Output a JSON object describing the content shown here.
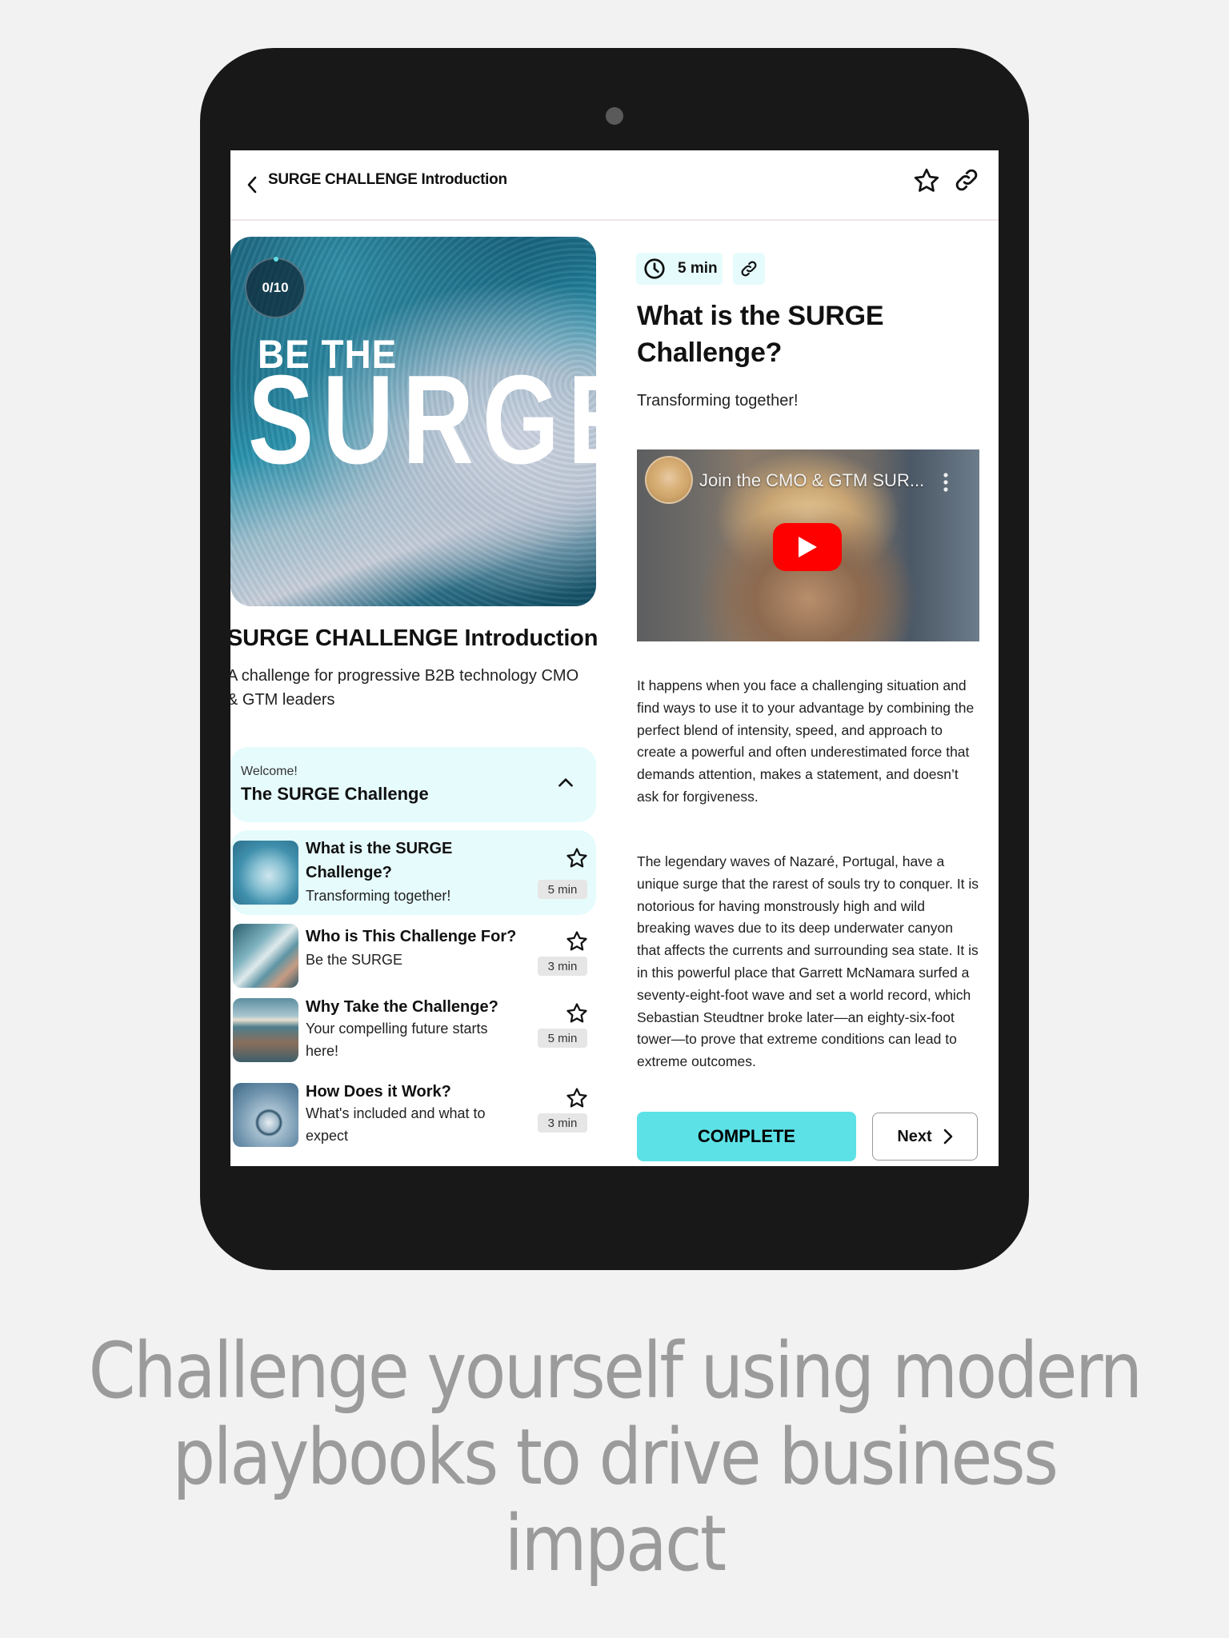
{
  "device": {
    "type": "tablet"
  },
  "topbar": {
    "back_icon": "chevron-left-icon",
    "title": "SURGE CHALLENGE Introduction",
    "favorite_icon": "star-outline-icon",
    "share_icon": "link-icon"
  },
  "course": {
    "hero": {
      "progress": "0/10",
      "progress_completed": 0,
      "progress_total": 10,
      "line1": "BE THE",
      "line2": "SURGE"
    },
    "title": "SURGE CHALLENGE Introduction",
    "description": "A challenge for progressive B2B technology CMO & GTM leaders"
  },
  "module": {
    "kicker": "Welcome!",
    "title": "The SURGE Challenge",
    "expanded": true,
    "toggle_icon": "chevron-up-icon"
  },
  "lessons": [
    {
      "title": "What is the SURGE Challenge?",
      "subtitle": "Transforming together!",
      "duration": "5 min",
      "active": true,
      "thumb": "wave"
    },
    {
      "title": "Who is This Challenge For?",
      "subtitle": "Be the SURGE",
      "duration": "3 min",
      "active": false,
      "thumb": "sailing-winch"
    },
    {
      "title": "Why Take the Challenge?",
      "subtitle": "Your compelling future starts here!",
      "duration": "5 min",
      "active": false,
      "thumb": "pier"
    },
    {
      "title": "How Does it Work?",
      "subtitle": "What's included and what to expect",
      "duration": "3 min",
      "active": false,
      "thumb": "compass"
    }
  ],
  "lesson_detail": {
    "duration": "5 min",
    "clock_icon": "clock-icon",
    "link_icon": "link-icon",
    "title": "What is the SURGE Challenge?",
    "subtitle": "Transforming together!",
    "video": {
      "title": "Join the CMO & GTM SUR...",
      "play_icon": "youtube-play-icon",
      "menu_icon": "more-vertical-icon"
    },
    "paragraphs": [
      "It happens when you face a challenging situation and find ways to use it to your advantage by combining the perfect blend of intensity, speed, and approach to create a powerful and often underestimated force that demands attention, makes a statement, and doesn’t ask for forgiveness.",
      "The legendary waves of Nazaré, Portugal, have a unique surge that the rarest of souls try to conquer. It is notorious for having monstrously high and wild breaking waves due to its deep underwater canyon that affects the currents and surrounding sea state. It is in this powerful place that Garrett McNamara surfed a seventy-eight-foot wave and set a world record, which Sebastian Steudtner broke later—an eighty-six-foot tower—to prove that extreme conditions can lead to extreme outcomes."
    ],
    "complete_label": "COMPLETE",
    "next_label": "Next"
  },
  "tagline": "Challenge yourself using modern playbooks to drive business impact",
  "colors": {
    "accent": "#5ce1e6",
    "accent_light": "#e6fbfc",
    "bezel": "#181818",
    "background": "#f2f2f2",
    "tagline": "#9b9b9b",
    "youtube_red": "#ff0000"
  }
}
